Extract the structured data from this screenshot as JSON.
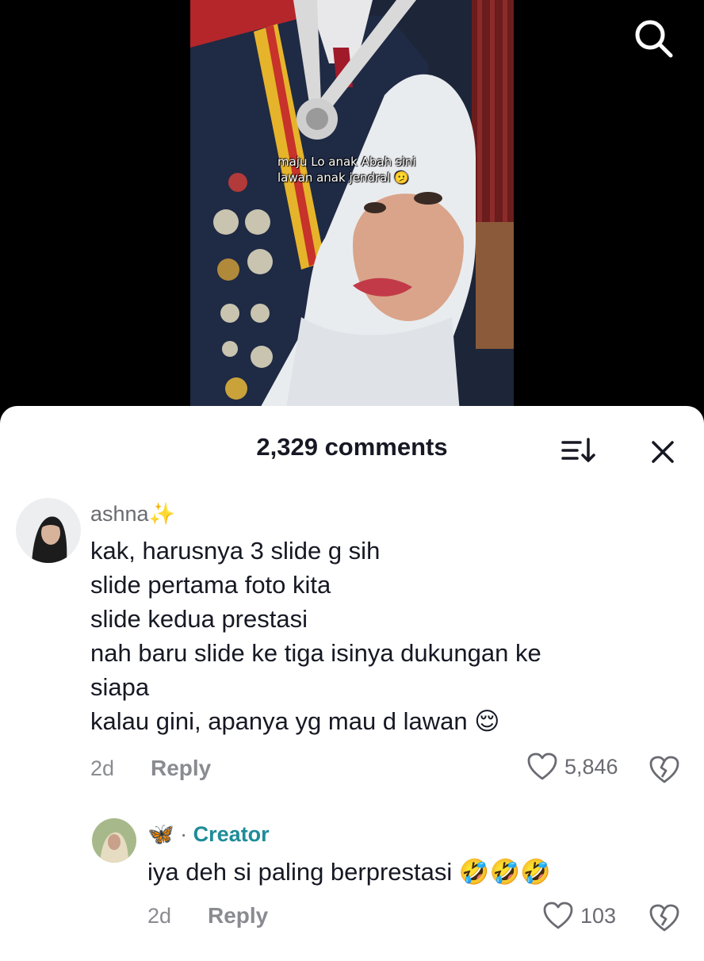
{
  "video": {
    "caption_line1": "maju Lo anak Abah sini",
    "caption_line2": "lawan anak jendral 🫤"
  },
  "header": {
    "comment_count_label": "2,329 comments"
  },
  "comments": [
    {
      "username": "ashna✨",
      "text": "kak, harusnya 3 slide g sih\nslide pertama foto kita\nslide kedua prestasi\nnah baru slide ke tiga isinya dukungan ke\nsiapa\nkalau gini, apanya yg mau d lawan 😌",
      "age": "2d",
      "reply_label": "Reply",
      "likes": "5,846"
    }
  ],
  "reply": {
    "username_emoji": "🦋",
    "separator": "·",
    "creator_label": "Creator",
    "text": "iya deh si paling berprestasi 🤣🤣🤣",
    "age": "2d",
    "reply_label": "Reply",
    "likes": "103"
  },
  "colors": {
    "creator": "#1e8c99",
    "sheet_bg": "#ffffff",
    "text_primary": "#161823",
    "text_secondary": "#8a8b91"
  }
}
